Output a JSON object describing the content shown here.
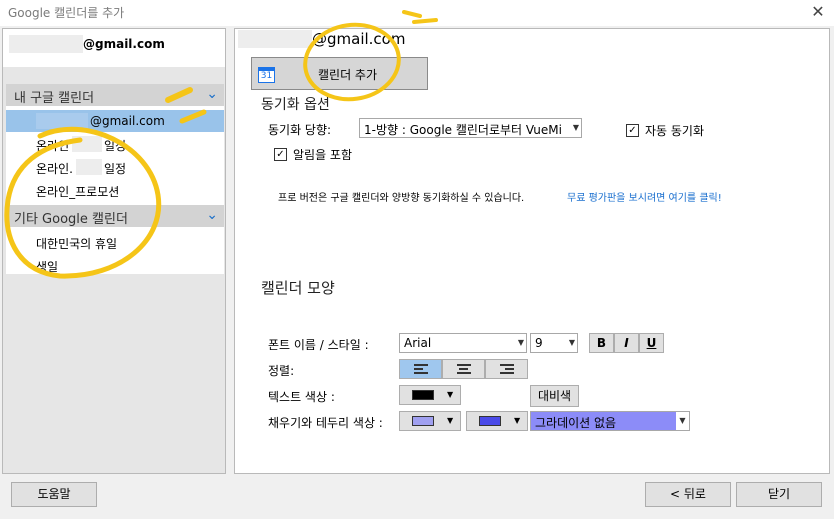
{
  "window": {
    "title": "Google 캘린더를 추가",
    "close_glyph": "✕"
  },
  "left": {
    "account_suffix": "@gmail.com",
    "my_calendars_header": "내 구글 캘린더",
    "my_calendars": [
      {
        "label": "@gmail.com",
        "selected": true
      },
      {
        "label_a": "온라인",
        "label_b": "일정"
      },
      {
        "label_a": "온라인.",
        "label_b": "일정"
      },
      {
        "label": "온라인_프로모션"
      }
    ],
    "other_header": "기타 Google 캘린더",
    "other_calendars": [
      "대한민국의 휴일",
      "생일"
    ]
  },
  "right": {
    "account_suffix": "@gmail.com",
    "add_button": "캘린더 추가",
    "cal_icon_text": "31",
    "sync_section": "동기화 옵션",
    "sync_target_label": "동기화 당향:",
    "sync_target_value": "1-방향 : Google 캘린더로부터 VueMi",
    "auto_sync_label": "자동 동기화",
    "include_alarm_label": "알림을 포함",
    "pro_note": "프로 버전은 구글 캘린더와 양방향 동기화하실 수 있습니다.",
    "pro_link": "무료 평가판을 보시려면 여기를 클릭!",
    "appearance_section": "캘린더 모양",
    "font_label": "폰트 이름 / 스타일 :",
    "font_name": "Arial",
    "font_size": "9",
    "bold": "B",
    "italic": "I",
    "underline": "U",
    "align_label": "정렬:",
    "text_color_label": "텍스트 색상 :",
    "contrast_button": "대비색",
    "fill_border_label": "채우기와 테두리 색상 :",
    "gradient_value": "그라데이션 없음",
    "colors": {
      "text": "#000000",
      "fill": "#a0a0f0",
      "border": "#4a4ae8",
      "gradient_bg": "#8c8cf8"
    }
  },
  "footer": {
    "help": "도움말",
    "back": "< 뒤로",
    "close": "닫기"
  }
}
